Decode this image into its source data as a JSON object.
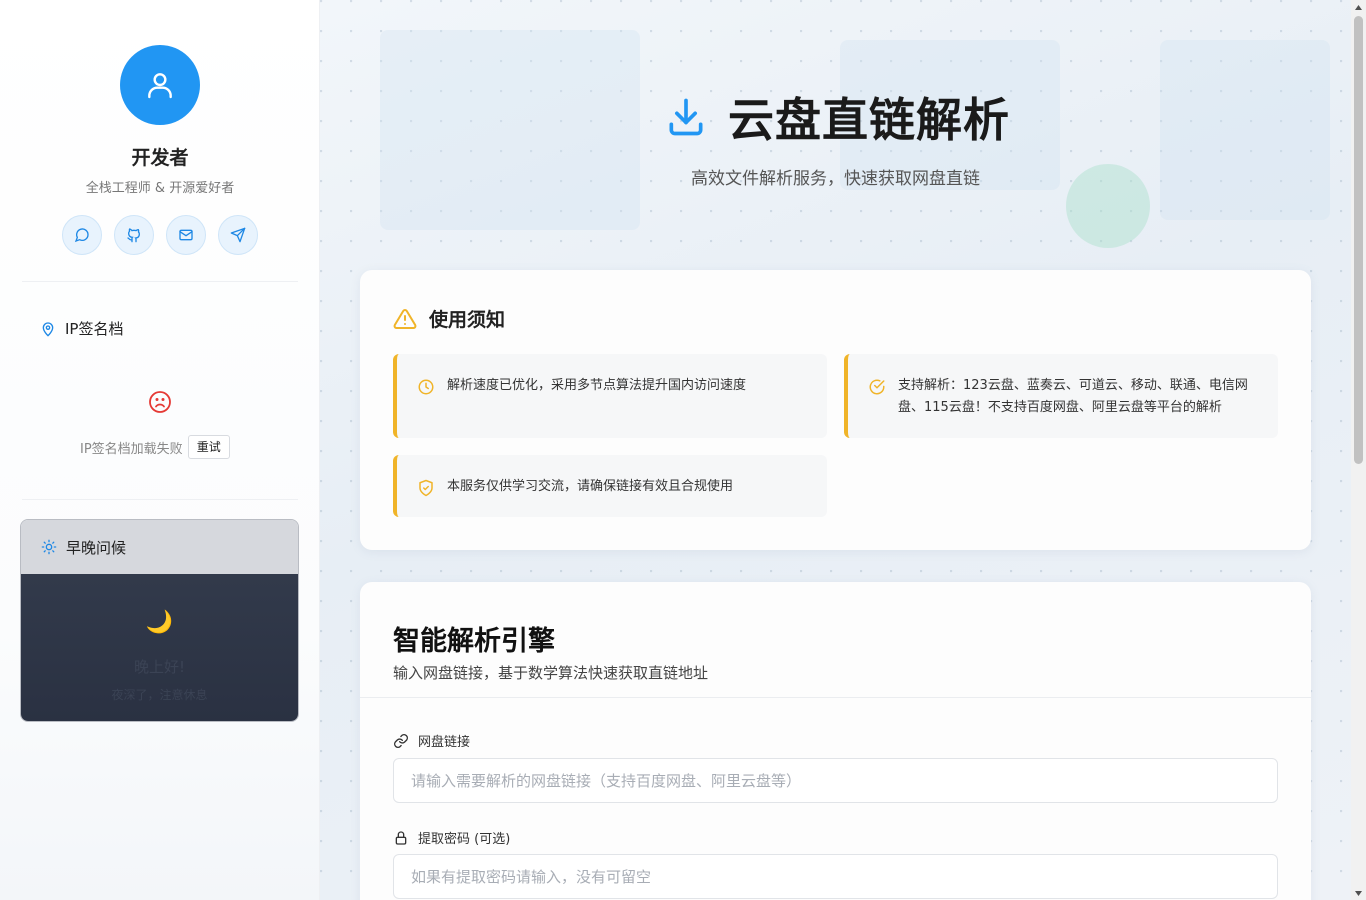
{
  "sidebar": {
    "profile": {
      "name": "开发者",
      "subtitle": "全栈工程师 & 开源爱好者",
      "social": [
        "chat-icon",
        "github-icon",
        "mail-icon",
        "send-icon"
      ]
    },
    "ip_section": {
      "title": "IP签名档",
      "error_text": "IP签名档加载失败",
      "retry_label": "重试"
    },
    "greeting": {
      "title": "早晚问候",
      "message": "晚上好!",
      "note": "夜深了，注意休息"
    }
  },
  "hero": {
    "title": "云盘直链解析",
    "subtitle": "高效文件解析服务，快速获取网盘直链"
  },
  "notice": {
    "title": "使用须知",
    "items": [
      "解析速度已优化，采用多节点算法提升国内访问速度",
      "支持解析：123云盘、蓝奏云、可道云、移动、联通、电信网盘、115云盘！不支持百度网盘、阿里云盘等平台的解析",
      "本服务仅供学习交流，请确保链接有效且合规使用"
    ]
  },
  "engine": {
    "title": "智能解析引擎",
    "subtitle": "输入网盘链接，基于数学算法快速获取直链地址",
    "link_label": "网盘链接",
    "link_value": "",
    "link_placeholder": "请输入需要解析的网盘链接（支持百度网盘、阿里云盘等）",
    "pwd_label": "提取密码 (可选)",
    "pwd_value": "",
    "pwd_placeholder": "如果有提取密码请输入，没有可留空"
  },
  "colors": {
    "primary": "#2196f3",
    "warning": "#f0b429",
    "error": "#e53935"
  }
}
